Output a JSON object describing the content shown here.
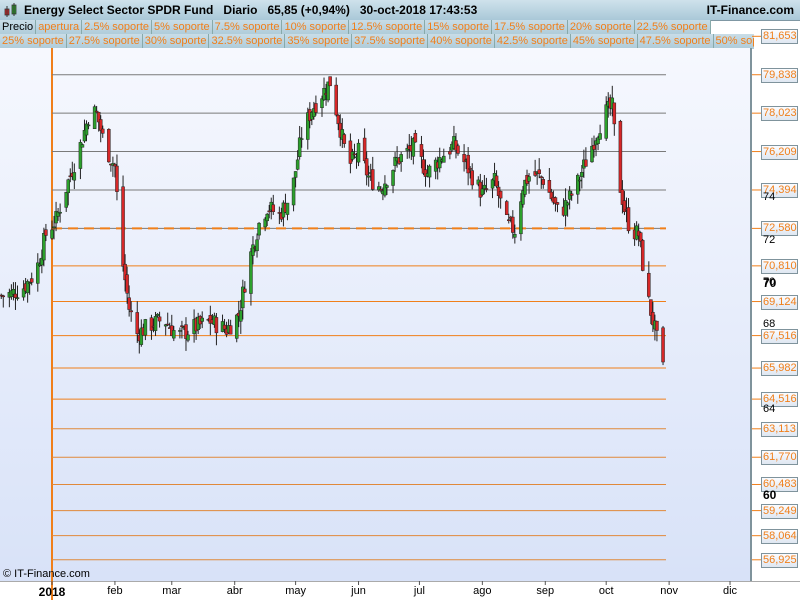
{
  "header": {
    "title": "Energy Select Sector SPDR Fund",
    "period": "Diario",
    "price": "65,85 (+0,94%)",
    "datetime": "30-oct-2018 17:43:53",
    "brand": "IT-Finance.com"
  },
  "legend_row1": [
    "Precio",
    "apertura",
    "2.5% soporte",
    "5% soporte",
    "7.5% soporte",
    "10% soporte",
    "12.5% soporte",
    "15% soporte",
    "17.5% soporte",
    "20% soporte",
    "22.5% soporte"
  ],
  "legend_row2": [
    "25% soporte",
    "27.5% soporte",
    "30% soporte",
    "32.5% soporte",
    "35% soporte",
    "37.5% soporte",
    "40% soporte",
    "42.5% soporte",
    "45% soporte",
    "47.5% soporte",
    "50% soporte"
  ],
  "copyright": "© IT-Finance.com",
  "colors": {
    "accent": "#f07f1a",
    "up": "#2ca02c",
    "down": "#d62728"
  },
  "chart_data": {
    "type": "candlestick",
    "title": "Energy Select Sector SPDR Fund",
    "ylim": [
      56.2,
      82.4
    ],
    "y_ticks": [
      "64",
      "68",
      "70",
      "72",
      "74"
    ],
    "y_ticks_bold": [
      "70",
      "60"
    ],
    "x_ticks": [
      "2018",
      "feb",
      "mar",
      "abr",
      "may",
      "jun",
      "jul",
      "ago",
      "sep",
      "oct",
      "nov",
      "dic"
    ],
    "x_tick_days": [
      0,
      31,
      59,
      90,
      120,
      151,
      181,
      212,
      243,
      273,
      304,
      334
    ],
    "opening_level": "72,580",
    "support_levels": [
      "81,653",
      "79,838",
      "78,023",
      "76,209",
      "74,394",
      "72,580",
      "70,810",
      "69,124",
      "67,516",
      "65,982",
      "64,516",
      "63,113",
      "61,770",
      "60,483",
      "59,249",
      "58,064",
      "56,925"
    ],
    "close_path_days": [
      -25,
      -20,
      -14,
      -8,
      -3,
      2,
      8,
      14,
      19,
      22,
      26,
      31,
      34,
      38,
      42,
      48,
      55,
      62,
      70,
      78,
      86,
      92,
      97,
      102,
      106,
      112,
      118,
      123,
      128,
      132,
      137,
      142,
      146,
      151,
      156,
      162,
      170,
      178,
      185,
      192,
      198,
      205,
      212,
      218,
      224,
      228,
      232,
      236,
      242,
      250,
      258,
      264,
      268,
      272,
      276,
      279,
      282,
      285,
      289,
      293,
      297,
      301
    ],
    "close_path": [
      69.4,
      69.5,
      69.8,
      70.5,
      72.3,
      73.0,
      74.8,
      76.5,
      78.2,
      78.0,
      76.5,
      75.5,
      71.5,
      68.8,
      67.6,
      68.0,
      68.3,
      67.5,
      67.9,
      68.2,
      67.8,
      68.5,
      71.0,
      72.8,
      73.6,
      73.2,
      74.2,
      77.0,
      78.2,
      78.8,
      79.5,
      77.3,
      75.5,
      76.2,
      75.0,
      74.5,
      75.8,
      76.4,
      75.2,
      76.0,
      76.5,
      75.4,
      74.2,
      74.8,
      72.8,
      72.5,
      74.6,
      75.2,
      74.9,
      73.2,
      74.5,
      76.0,
      77.0,
      78.0,
      78.3,
      75.0,
      73.5,
      72.5,
      72.3,
      69.5,
      67.8,
      65.9
    ]
  }
}
